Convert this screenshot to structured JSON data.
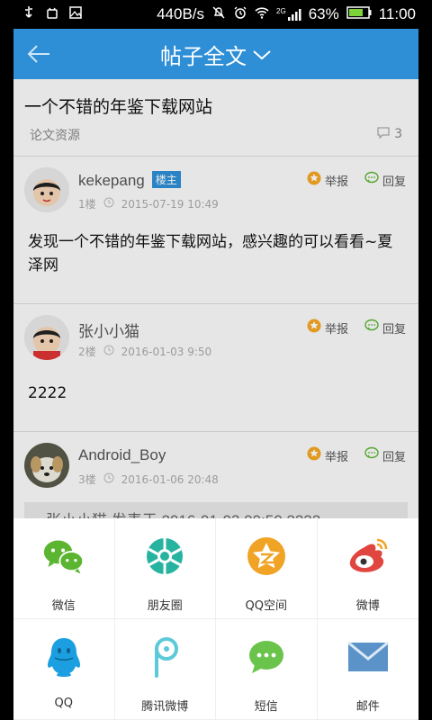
{
  "status_bar": {
    "net_speed": "440B/s",
    "network": "2G",
    "battery": "63%",
    "time": "11:00"
  },
  "appbar": {
    "title": "帖子全文"
  },
  "post": {
    "title": "一个不错的年鉴下载网站",
    "category": "论文资源",
    "comment_count": "3"
  },
  "replies": [
    {
      "username": "kekepang",
      "badge": "楼主",
      "floor": "1楼",
      "time": "2015-07-19 10:49",
      "body": "发现一个不错的年鉴下载网站，感兴趣的可以看看~夏泽网",
      "report": "举报",
      "reply": "回复"
    },
    {
      "username": "张小小猫",
      "floor": "2楼",
      "time": "2016-01-03 9:50",
      "body": "2222",
      "report": "举报",
      "reply": "回复"
    },
    {
      "username": "Android_Boy",
      "floor": "3楼",
      "time": "2016-01-06 20:48",
      "quote": "张小小猫 发表于 2016-01-03 09:50   2222",
      "report": "举报",
      "reply": "回复"
    }
  ],
  "share_sheet": [
    {
      "label": "微信",
      "icon": "wechat-icon"
    },
    {
      "label": "朋友圈",
      "icon": "moments-icon"
    },
    {
      "label": "QQ空间",
      "icon": "qzone-icon"
    },
    {
      "label": "微博",
      "icon": "weibo-icon"
    },
    {
      "label": "QQ",
      "icon": "qq-icon"
    },
    {
      "label": "腾讯微博",
      "icon": "tencent-weibo-icon"
    },
    {
      "label": "短信",
      "icon": "sms-icon"
    },
    {
      "label": "邮件",
      "icon": "mail-icon"
    }
  ],
  "colors": {
    "appbar": "#2e8fd6",
    "badge": "#2e8fd6",
    "wechat": "#5bb531",
    "qzone": "#f0a325",
    "weibo": "#e0463f",
    "qq": "#1b9fe0",
    "mail": "#5b93c9"
  }
}
